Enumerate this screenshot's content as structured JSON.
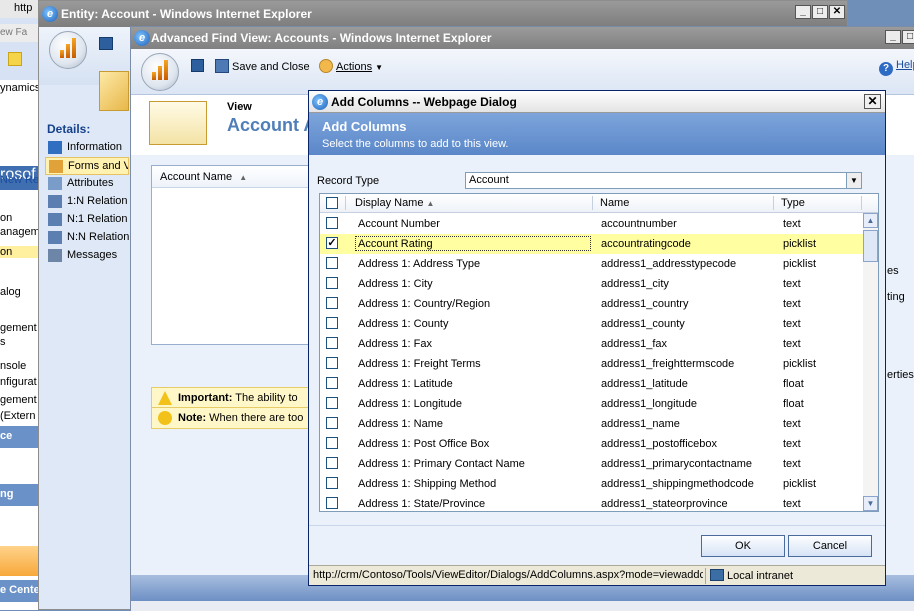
{
  "background_browser": {
    "url_fragment": "http",
    "menu_fragment": "ew   Fa",
    "nav_items": [
      "ynamics",
      "rosof",
      "New Re",
      "on",
      "anageme",
      "on",
      "alog",
      "gement",
      "s",
      "nsole",
      "nfigurat",
      "gement",
      "(Extern"
    ],
    "nav_bands": [
      "ce",
      "ng",
      "e Cente"
    ]
  },
  "entity_window": {
    "title": "Entity: Account - Windows Internet Explorer",
    "details_title": "Details:",
    "nav_items": [
      "Information",
      "Forms and V",
      "Attributes",
      "1:N Relation",
      "N:1 Relation",
      "N:N Relation",
      "Messages"
    ],
    "selected_nav_index": 1
  },
  "advanced_find": {
    "title": "Advanced Find View: Accounts - Windows Internet Explorer",
    "save_close_label": "Save and Close",
    "actions_label": "Actions",
    "help_label": "Help",
    "view_label": "View",
    "view_name": "Account A",
    "preview_column_header": "Account Name",
    "important_label": "Important:",
    "important_text": "The ability to",
    "note_label": "Note:",
    "note_text": "When there are too",
    "right_peek_1": "es",
    "right_peek_2": "ting",
    "right_peek_3": "erties"
  },
  "dialog": {
    "title": "Add Columns -- Webpage Dialog",
    "close_label": "✕",
    "heading": "Add Columns",
    "subheading": "Select the columns to add to this view.",
    "record_type_label": "Record Type",
    "record_type_value": "Account",
    "columns": {
      "display_name": "Display Name",
      "name": "Name",
      "type": "Type"
    },
    "rows": [
      {
        "display": "Account Number",
        "name": "accountnumber",
        "type": "text",
        "checked": false
      },
      {
        "display": "Account Rating",
        "name": "accountratingcode",
        "type": "picklist",
        "checked": true
      },
      {
        "display": "Address 1: Address Type",
        "name": "address1_addresstypecode",
        "type": "picklist",
        "checked": false
      },
      {
        "display": "Address 1: City",
        "name": "address1_city",
        "type": "text",
        "checked": false
      },
      {
        "display": "Address 1: Country/Region",
        "name": "address1_country",
        "type": "text",
        "checked": false
      },
      {
        "display": "Address 1: County",
        "name": "address1_county",
        "type": "text",
        "checked": false
      },
      {
        "display": "Address 1: Fax",
        "name": "address1_fax",
        "type": "text",
        "checked": false
      },
      {
        "display": "Address 1: Freight Terms",
        "name": "address1_freighttermscode",
        "type": "picklist",
        "checked": false
      },
      {
        "display": "Address 1: Latitude",
        "name": "address1_latitude",
        "type": "float",
        "checked": false
      },
      {
        "display": "Address 1: Longitude",
        "name": "address1_longitude",
        "type": "float",
        "checked": false
      },
      {
        "display": "Address 1: Name",
        "name": "address1_name",
        "type": "text",
        "checked": false
      },
      {
        "display": "Address 1: Post Office Box",
        "name": "address1_postofficebox",
        "type": "text",
        "checked": false
      },
      {
        "display": "Address 1: Primary Contact Name",
        "name": "address1_primarycontactname",
        "type": "text",
        "checked": false
      },
      {
        "display": "Address 1: Shipping Method",
        "name": "address1_shippingmethodcode",
        "type": "picklist",
        "checked": false
      },
      {
        "display": "Address 1: State/Province",
        "name": "address1_stateorprovince",
        "type": "text",
        "checked": false
      }
    ],
    "selected_row_index": 1,
    "ok_label": "OK",
    "cancel_label": "Cancel",
    "status_url": "http://crm/Contoso/Tools/ViewEditor/Dialogs/AddColumns.aspx?mode=viewaddcolumns",
    "status_zone": "Local intranet"
  },
  "colors": {
    "view_name": "#4f7fb8",
    "dialog_banner": "#6b95d1",
    "selected_row": "#fffea0"
  }
}
